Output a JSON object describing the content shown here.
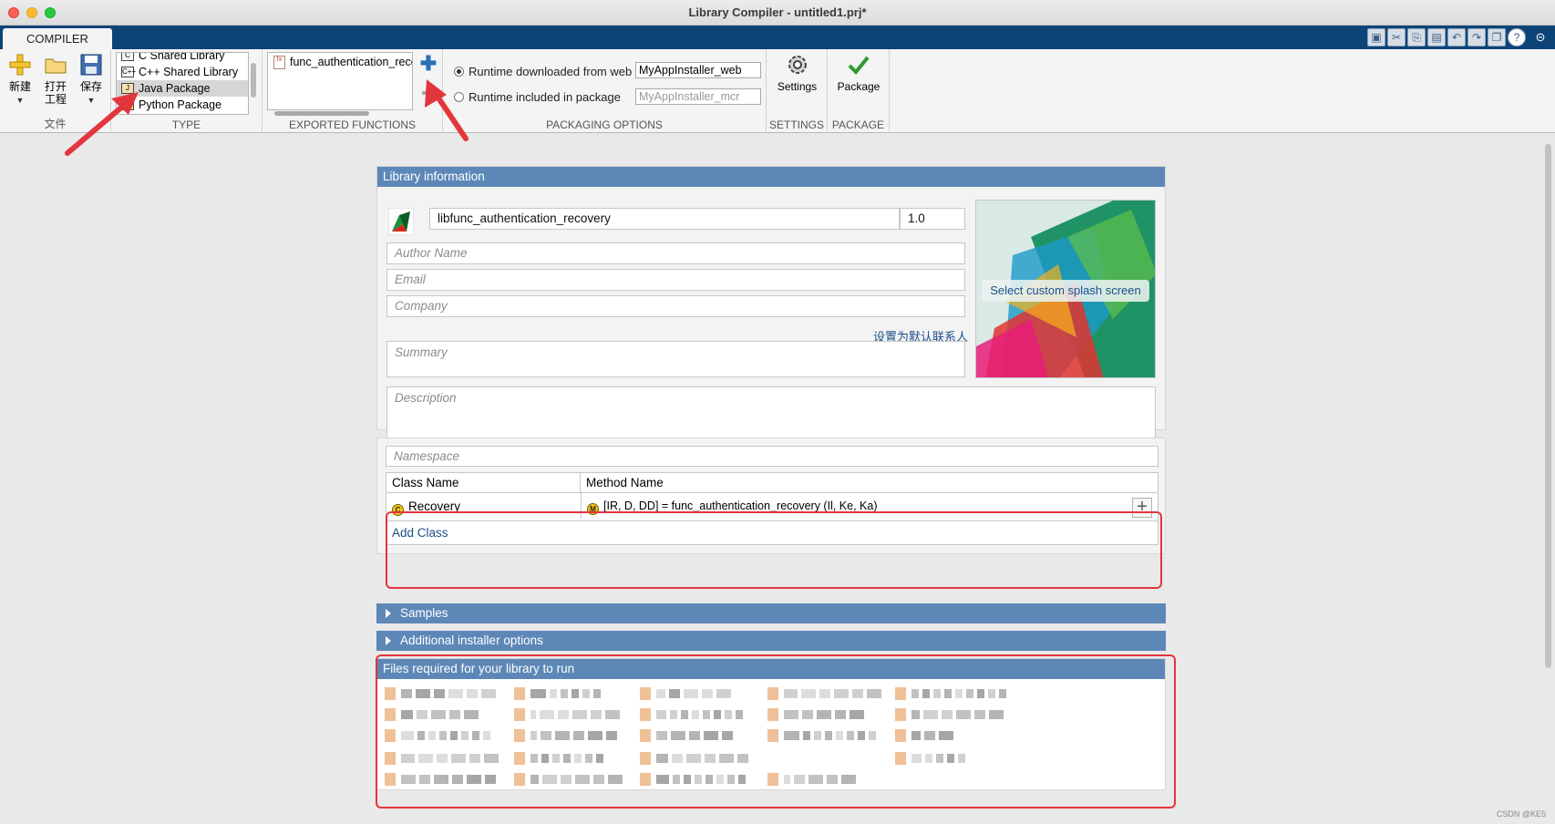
{
  "window": {
    "title": "Library Compiler - untitled1.prj*"
  },
  "tabs": {
    "compiler": "COMPILER"
  },
  "ribbon": {
    "file_section": {
      "label": "文件",
      "new_label": "新建",
      "open_label": "打开\n工程",
      "save_label": "保存"
    },
    "type_section": {
      "label": "TYPE",
      "items": [
        {
          "label": "C Shared Library",
          "icon": "C"
        },
        {
          "label": "C++ Shared Library",
          "icon": "C++"
        },
        {
          "label": "Java Package",
          "icon": "J"
        },
        {
          "label": "Python Package",
          "icon": "Py"
        }
      ],
      "selected": "Java Package"
    },
    "exported_functions": {
      "label": "EXPORTED FUNCTIONS",
      "item": "func_authentication_recovery.m",
      "icon": "m-file-icon"
    },
    "packaging_options": {
      "label": "PACKAGING OPTIONS",
      "runtime_web_label": "Runtime downloaded from web",
      "runtime_web_value": "MyAppInstaller_web",
      "runtime_pkg_label": "Runtime included in package",
      "runtime_pkg_placeholder": "MyAppInstaller_mcr",
      "selected": "Runtime downloaded from web"
    },
    "settings": {
      "label": "SETTINGS",
      "button_label": "Settings"
    },
    "package": {
      "label": "PACKAGE",
      "button_label": "Package"
    }
  },
  "library_info": {
    "header": "Library information",
    "name": "libfunc_authentication_recovery",
    "version": "1.0",
    "author_placeholder": "Author Name",
    "email_placeholder": "Email",
    "company_placeholder": "Company",
    "set_default_contact": "设置为默认联系人",
    "summary_placeholder": "Summary",
    "description_placeholder": "Description",
    "splash_label": "Select custom splash screen"
  },
  "classes": {
    "namespace_placeholder": "Namespace",
    "columns": [
      "Class Name",
      "Method Name"
    ],
    "rows": [
      {
        "class_name": "Recovery",
        "method": "[IR, D, DD] = func_authentication_recovery (Il, Ke, Ka)"
      }
    ],
    "add_class_label": "Add Class"
  },
  "sections": {
    "samples": "Samples",
    "additional_installer": "Additional installer options",
    "files_required": "Files required for your library to run"
  },
  "files_required": {
    "visible_file": "func_randpixel_de..."
  },
  "watermark": "CSDN @KE5",
  "colors": {
    "tab_strip": "#0d4478",
    "section_header": "#5d87b7",
    "link": "#1c4f8a",
    "highlight_red": "#e2363d"
  }
}
